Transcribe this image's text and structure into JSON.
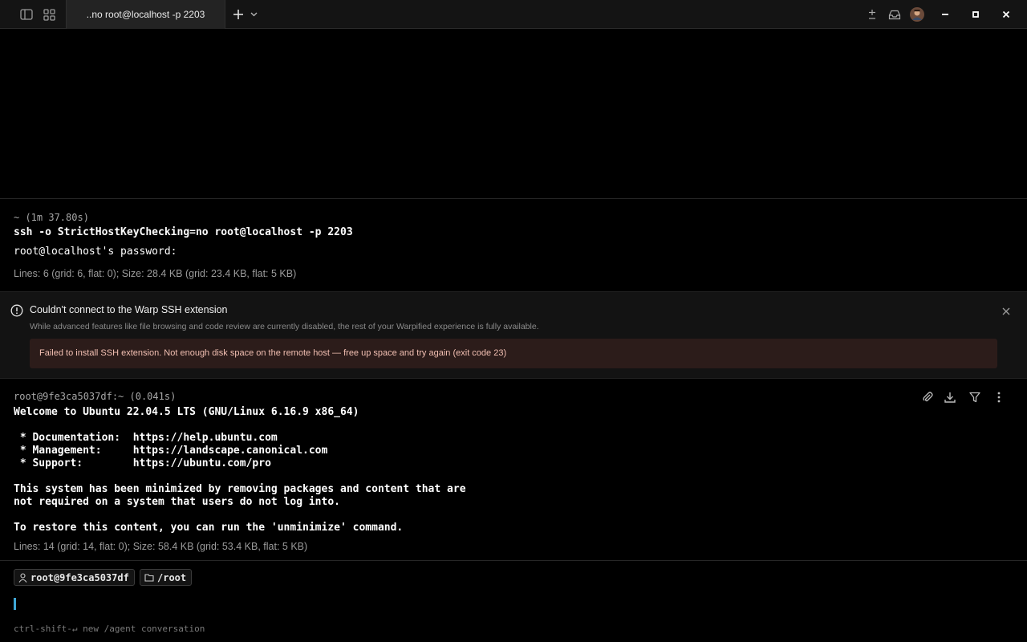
{
  "titlebar": {
    "tab_title": "..no root@localhost -p 2203",
    "icons": [
      "sidebar-toggle-icon",
      "grid-icon",
      "plus-icon",
      "chevron-down-icon",
      "plus-minus-icon",
      "inbox-icon",
      "avatar",
      "minimize-icon",
      "maximize-icon",
      "close-icon"
    ]
  },
  "block1": {
    "meta": "~ (1m 37.80s)",
    "command": "ssh -o StrictHostKeyChecking=no root@localhost -p 2203",
    "output": "root@localhost's password:",
    "stats": "Lines: 6 (grid: 6, flat: 0); Size: 28.4 KB (grid: 23.4 KB, flat: 5 KB)"
  },
  "ssh_warning": {
    "title": "Couldn't connect to the Warp SSH extension",
    "description": "While advanced features like file browsing and code review are currently disabled, the rest of your Warpified experience is fully available.",
    "error": "Failed to install SSH extension. Not enough disk space on the remote host — free up space and try again (exit code 23)"
  },
  "block2": {
    "meta": "root@9fe3ca5037df:~ (0.041s)",
    "command": "Welcome to Ubuntu 22.04.5 LTS (GNU/Linux 6.16.9 x86_64)",
    "lines": [
      " * Documentation:  https://help.ubuntu.com",
      " * Management:     https://landscape.canonical.com",
      " * Support:        https://ubuntu.com/pro",
      "This system has been minimized by removing packages and content that are",
      "not required on a system that users do not log into.",
      "To restore this content, you can run the 'unminimize' command."
    ],
    "stats": "Lines: 14 (grid: 14, flat: 0); Size: 58.4 KB (grid: 53.4 KB, flat: 5 KB)",
    "actions": [
      "paperclip-icon",
      "download-icon",
      "filter-icon",
      "more-vertical-icon"
    ]
  },
  "input": {
    "user_chip": "root@9fe3ca5037df",
    "dir_chip": "/root",
    "hint": "ctrl-shift-↵ new /agent conversation"
  },
  "colors": {
    "background": "#000000",
    "titlebar": "#141414",
    "cursor": "#3fa7d6",
    "error_bg": "#2c1c1a",
    "error_text": "#f2bfb2"
  }
}
